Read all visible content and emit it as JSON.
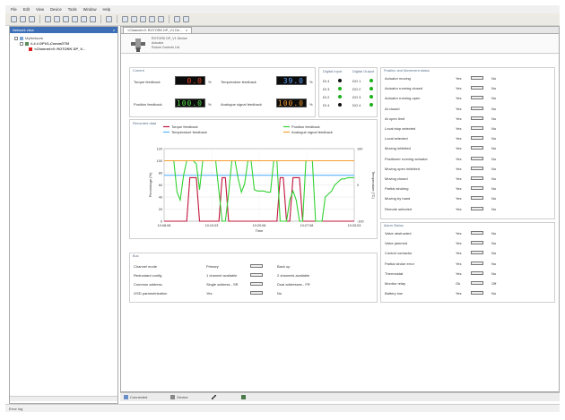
{
  "menu": [
    "File",
    "Edit",
    "View",
    "Device",
    "Tools",
    "Window",
    "Help"
  ],
  "network_view": {
    "title": "Network view",
    "close": "x",
    "items": [
      {
        "label": "MyNetwork",
        "indent": 0
      },
      {
        "label": "#.#.# DPV1-CommDTM",
        "indent": 1
      },
      {
        "label": "<Channel>0: ROTORK DP_V...",
        "indent": 2
      }
    ]
  },
  "tab": {
    "label": "<Channel>0: ROTORK DP_V1 De...",
    "close": "x"
  },
  "device": {
    "line1": "ROTORK DP_V1 Device",
    "line2": "Actuator",
    "line3": "Rotork Controls Ltd"
  },
  "current": {
    "title": "Current",
    "fields": [
      {
        "label": "Torque feedback",
        "value": "0.0",
        "unit": "%",
        "color": "#e8401e"
      },
      {
        "label": "Temperature feedback",
        "value": "39.0",
        "unit": "%",
        "color": "#5aa0ff"
      },
      {
        "label": "Position feedback",
        "value": "100.0",
        "unit": "%",
        "color": "#52e04a"
      },
      {
        "label": "Analogue signal feedback",
        "value": "100.0",
        "unit": "%",
        "color": "#f49b2a"
      }
    ]
  },
  "digital_input": {
    "title": "Digital Input",
    "items": [
      {
        "label": "DI 4",
        "on": true
      },
      {
        "label": "DI 3",
        "on": false
      },
      {
        "label": "DI 2",
        "on": false
      },
      {
        "label": "DI 4",
        "on": false
      }
    ]
  },
  "digital_output": {
    "title": "Digital Output",
    "items": [
      {
        "label": "DO 1",
        "on": true
      },
      {
        "label": "DO 2",
        "on": true
      },
      {
        "label": "DO 3",
        "on": true
      },
      {
        "label": "DO 4",
        "on": true
      }
    ]
  },
  "position_status": {
    "title": "Position and Movement status",
    "items": [
      {
        "label": "Actuator moving",
        "yes": "Yes",
        "no": "No"
      },
      {
        "label": "Actuator running closed",
        "yes": "Yes",
        "no": "No"
      },
      {
        "label": "Actuator running open",
        "yes": "Yes",
        "no": "No"
      },
      {
        "label": "At closed",
        "yes": "Yes",
        "no": "No"
      },
      {
        "label": "At open limit",
        "yes": "Yes",
        "no": "No"
      },
      {
        "label": "Local stop selected",
        "yes": "Yes",
        "no": "No"
      },
      {
        "label": "Local selected",
        "yes": "Yes",
        "no": "No"
      },
      {
        "label": "Moving inhibited",
        "yes": "Yes",
        "no": "No"
      },
      {
        "label": "Positioner running actuator",
        "yes": "Yes",
        "no": "No"
      },
      {
        "label": "Moving open inhibited",
        "yes": "Yes",
        "no": "No"
      },
      {
        "label": "Moving closed",
        "yes": "Yes",
        "no": "No"
      },
      {
        "label": "Partial stroking",
        "yes": "Yes",
        "no": "No"
      },
      {
        "label": "Moving by hand",
        "yes": "Yes",
        "no": "No"
      },
      {
        "label": "Remote selected",
        "yes": "Yes",
        "no": "No"
      }
    ]
  },
  "alarm_status": {
    "title": "Alarm Status",
    "items": [
      {
        "label": "Valve obstructed",
        "yes": "Yes",
        "no": "No"
      },
      {
        "label": "Valve jammed",
        "yes": "Yes",
        "no": "No"
      },
      {
        "label": "Control contactor",
        "yes": "Yes",
        "no": "No"
      },
      {
        "label": "Partial stroke error",
        "yes": "Yes",
        "no": "No"
      },
      {
        "label": "Thermostat",
        "yes": "Yes",
        "no": "No"
      },
      {
        "label": "Monitor relay",
        "yes": "Ok",
        "no": "Off"
      },
      {
        "label": "Battery low",
        "yes": "Yes",
        "no": "No"
      }
    ]
  },
  "bus": {
    "title": "Bus",
    "rows": [
      {
        "label": "Channel mode",
        "left": "Primary",
        "right": "Back up"
      },
      {
        "label": "Redundant config",
        "left": "1 channel available",
        "right": "2 channels available"
      },
      {
        "label": "Common address",
        "left": "Single address - SR",
        "right": "Dual addresses - FR"
      },
      {
        "label": "GSD parametrization",
        "left": "Yes",
        "right": "No"
      }
    ]
  },
  "status_bar": {
    "connection": "Connected",
    "mode": "Device"
  },
  "bottom_status": "Error log",
  "chart_data": {
    "type": "line",
    "title": "Recorded data",
    "legend": [
      "Torque feedback",
      "Temperature feedback",
      "Position feedback",
      "Analogue signal feedback"
    ],
    "xlabel": "Time",
    "ylabel": "Percentage (%)",
    "y2label": "Temperature (°C)",
    "x_ticks": [
      "10:08:08",
      "10:10:03",
      "10:20:08",
      "10:27:08",
      "10:33:03"
    ],
    "y_ticks": [
      0,
      20,
      40,
      60,
      80,
      100,
      120
    ],
    "y2_ticks": [
      -100,
      0,
      100
    ],
    "ylim": [
      0,
      120
    ],
    "series": [
      {
        "name": "Torque feedback",
        "color": "#c0143c",
        "values": [
          0,
          0,
          0,
          0,
          0,
          0,
          0,
          0,
          72,
          72,
          72,
          0,
          0,
          0,
          0,
          0,
          0,
          0,
          72,
          72,
          0,
          0,
          0,
          0,
          0,
          0,
          0,
          0,
          0,
          0,
          0,
          0,
          0,
          0,
          0,
          0,
          72,
          72,
          0,
          0,
          72,
          72,
          72,
          0,
          0,
          0,
          0,
          0,
          0,
          0,
          0,
          0,
          0,
          0,
          0,
          0,
          0,
          0,
          0,
          0
        ]
      },
      {
        "name": "Temperature feedback",
        "color": "#5ab4ff",
        "values": [
          76,
          76,
          76,
          76,
          76,
          76,
          76,
          76,
          76,
          76,
          76,
          76,
          76,
          76,
          76,
          76,
          76,
          76,
          76,
          76,
          76,
          76,
          76,
          76,
          76,
          76,
          76,
          76,
          76,
          76,
          76,
          76,
          76,
          76,
          76,
          76,
          76,
          76,
          76,
          76,
          76,
          76,
          76,
          76,
          76,
          76,
          76,
          76,
          76,
          76,
          76,
          76,
          76,
          76,
          76,
          76,
          76,
          76,
          76,
          76
        ]
      },
      {
        "name": "Position feedback",
        "color": "#32d232",
        "values": [
          100,
          100,
          100,
          100,
          48,
          35,
          75,
          100,
          100,
          100,
          95,
          52,
          100,
          100,
          100,
          100,
          100,
          50,
          0,
          0,
          45,
          100,
          100,
          70,
          48,
          62,
          100,
          100,
          52,
          50,
          50,
          50,
          48,
          48,
          100,
          100,
          0,
          0,
          0,
          35,
          50,
          35,
          0,
          0,
          100,
          100,
          100,
          0,
          0,
          0,
          40,
          45,
          50,
          60,
          65,
          70,
          70,
          72,
          72,
          72
        ]
      },
      {
        "name": "Analogue signal feedback",
        "color": "#f5a030",
        "values": [
          100,
          100,
          100,
          100,
          100,
          100,
          100,
          100,
          100,
          100,
          100,
          100,
          100,
          100,
          100,
          100,
          100,
          100,
          100,
          100,
          100,
          100,
          100,
          100,
          100,
          100,
          100,
          100,
          100,
          100,
          100,
          100,
          100,
          100,
          100,
          100,
          100,
          100,
          100,
          100,
          100,
          100,
          100,
          100,
          100,
          100,
          100,
          100,
          100,
          100,
          100,
          100,
          100,
          100,
          100,
          100,
          100,
          100,
          100,
          100
        ]
      }
    ]
  }
}
